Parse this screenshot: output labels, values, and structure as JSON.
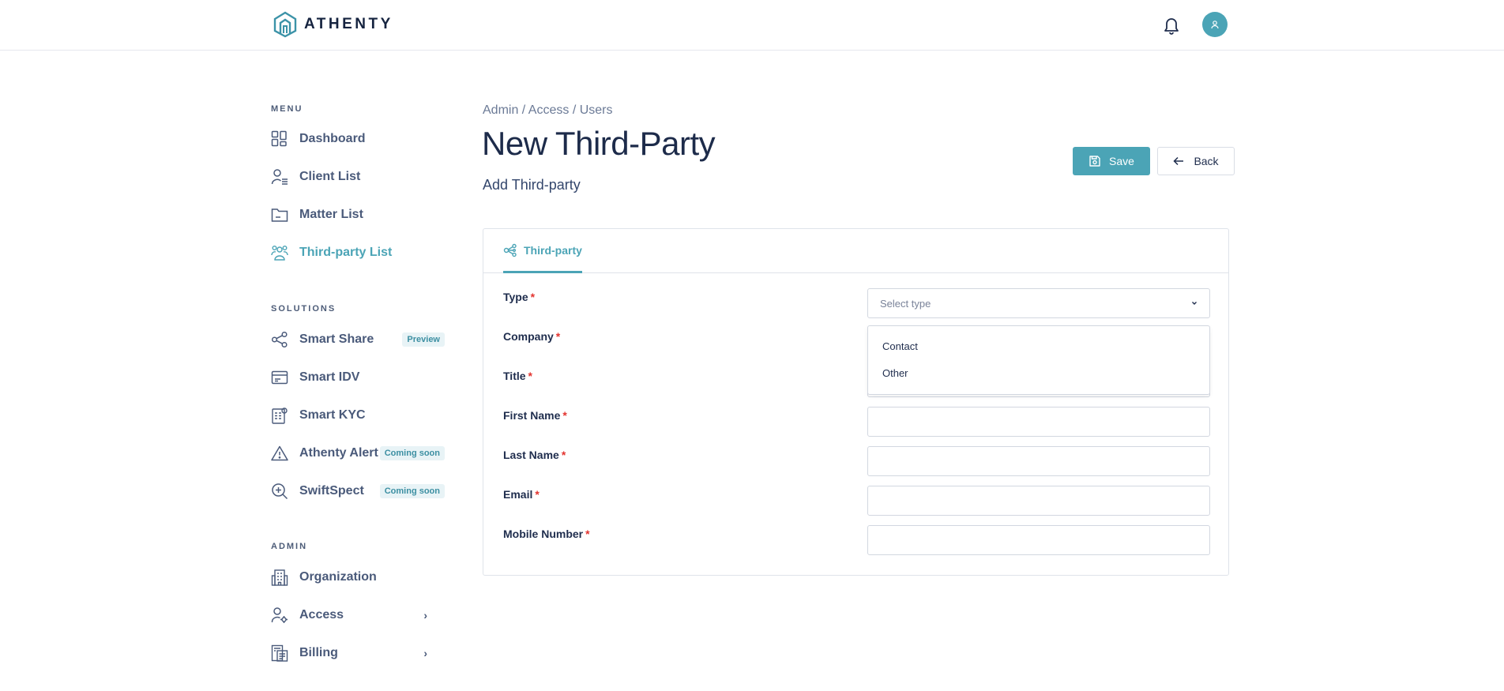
{
  "brand": {
    "name": "ATHENTY"
  },
  "header": {
    "bell_icon": "bell-icon",
    "avatar_icon": "user-icon"
  },
  "sidebar": {
    "menu_label": "MENU",
    "menu_items": [
      {
        "label": "Dashboard",
        "icon": "grid-icon"
      },
      {
        "label": "Client List",
        "icon": "user-list-icon"
      },
      {
        "label": "Matter List",
        "icon": "folder-icon"
      },
      {
        "label": "Third-party List",
        "icon": "users-icon",
        "active": true
      }
    ],
    "solutions_label": "SOLUTIONS",
    "solution_items": [
      {
        "label": "Smart Share",
        "icon": "share-icon",
        "badge": "Preview"
      },
      {
        "label": "Smart IDV",
        "icon": "id-card-icon"
      },
      {
        "label": "Smart KYC",
        "icon": "document-badge-icon"
      },
      {
        "label": "Athenty Alert",
        "icon": "alert-triangle-icon",
        "badge": "Coming soon"
      },
      {
        "label": "SwiftSpect",
        "icon": "zoom-in-icon",
        "badge": "Coming soon"
      }
    ],
    "admin_label": "ADMIN",
    "admin_items": [
      {
        "label": "Organization",
        "icon": "building-icon"
      },
      {
        "label": "Access",
        "icon": "user-gear-icon",
        "chevron": "›"
      },
      {
        "label": "Billing",
        "icon": "invoice-icon",
        "chevron": "›"
      }
    ]
  },
  "page": {
    "breadcrumb": "Admin / Access / Users",
    "title": "New Third-Party",
    "subtitle": "Add Third-party",
    "save_label": "Save",
    "back_label": "Back"
  },
  "form": {
    "tab_label": "Third-party",
    "fields": [
      {
        "label": "Type",
        "required": "*"
      },
      {
        "label": "Company",
        "required": "*"
      },
      {
        "label": "Title",
        "required": "*"
      },
      {
        "label": "First Name",
        "required": "*"
      },
      {
        "label": "Last Name",
        "required": "*"
      },
      {
        "label": "Email",
        "required": "*"
      },
      {
        "label": "Mobile Number",
        "required": "*"
      }
    ],
    "type_placeholder": "Select type",
    "type_options": [
      "Contact",
      "Other"
    ]
  },
  "colors": {
    "accent": "#4ba4b6",
    "text": "#1f2d4d",
    "required": "#e3342f"
  }
}
